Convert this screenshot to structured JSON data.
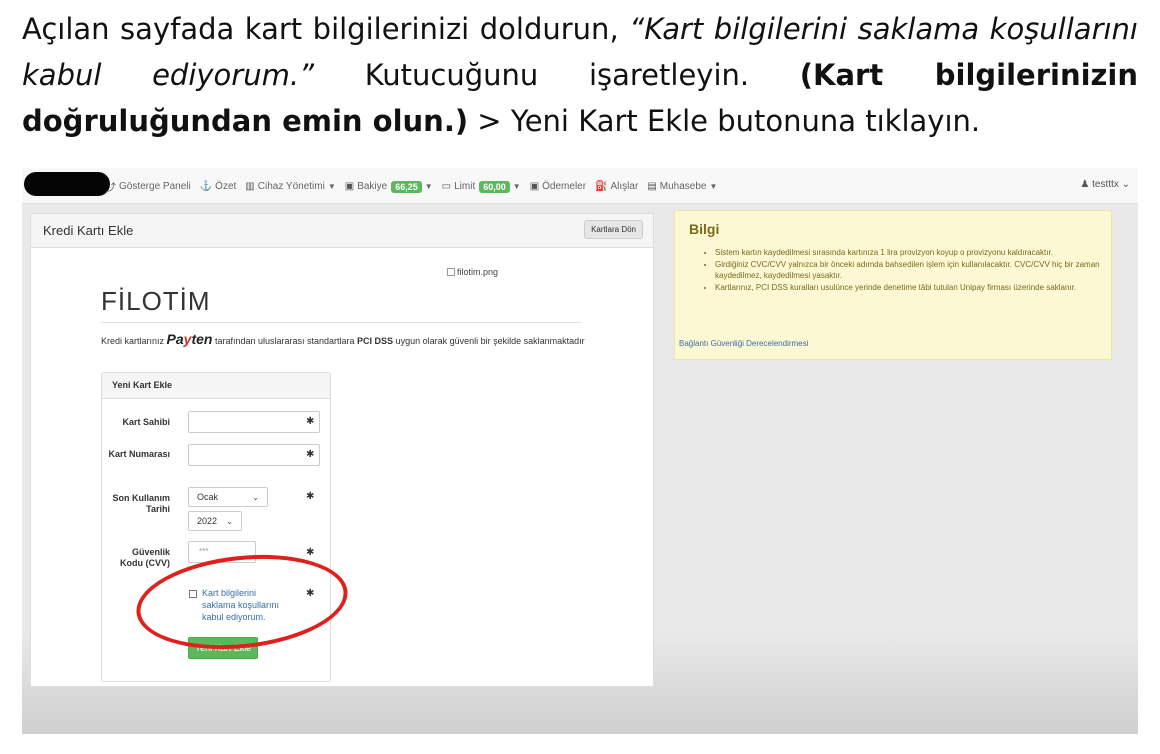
{
  "instruction": {
    "part1": "Açılan sayfada kart bilgilerinizi doldurun, ",
    "italic": "“Kart bilgilerini saklama koşullarını kabul ediyorum.”",
    "part2": " Kutucuğunu işaretleyin. ",
    "bold": "(Kart bilgilerinizin doğruluğundan emin olun.)",
    "part3": " > Yeni Kart Ekle butonuna tıklayın."
  },
  "nav": {
    "items": [
      {
        "icon": "chart-icon",
        "glyph": "⤴",
        "label": "Gösterge Paneli"
      },
      {
        "icon": "summary-icon",
        "glyph": "⚓",
        "label": "Özet"
      },
      {
        "icon": "device-icon",
        "glyph": "▥",
        "label": "Cihaz Yönetimi",
        "caret": true
      },
      {
        "icon": "balance-icon",
        "glyph": "▣",
        "label": "Bakiye",
        "badge": "66,25",
        "caret": true
      },
      {
        "icon": "limit-icon",
        "glyph": "▭",
        "label": "Limit",
        "badge": "60,00",
        "caret": true
      },
      {
        "icon": "payment-icon",
        "glyph": "▣",
        "label": "Ödemeler"
      },
      {
        "icon": "fuel-icon",
        "glyph": "⛽",
        "label": "Alışlar"
      },
      {
        "icon": "book-icon",
        "glyph": "▤",
        "label": "Muhasebe",
        "caret": true
      }
    ],
    "user": "testttx"
  },
  "panel": {
    "title": "Kredi Kartı Ekle",
    "back_button": "Kartlara Dön",
    "brand": "FİLOTİM",
    "logo_alt": "filotim.png",
    "pci_text_1": "Kredi kartlarınız ",
    "payten_pay": "Pa",
    "payten_y": "y",
    "payten_ten": "ten",
    "pci_text_2": " tarafından uluslararası standartlara ",
    "pci_bold": "PCI DSS",
    "pci_text_3": " uygun olarak güvenli bir şekilde saklanmaktadır"
  },
  "form": {
    "title": "Yeni Kart Ekle",
    "card_holder_label": "Kart Sahibi",
    "card_number_label": "Kart Numarası",
    "expiry_label": "Son Kullanım Tarihi",
    "expiry_month": "Ocak",
    "expiry_year": "2022",
    "cvv_label": "Güvenlik Kodu (CVV)",
    "cvv_placeholder": "***",
    "required_mark": "✱",
    "terms_label": "Kart bilgilerini saklama koşullarını kabul ediyorum.",
    "submit_button": "Yeni Kart Ekle"
  },
  "info": {
    "title": "Bilgi",
    "items": [
      "Sistem kartın kaydedilmesi sırasında kartınıza 1 lira provizyon koyup o provizyonu kaldıracaktır.",
      "Girdiğiniz CVC/CVV yalnızca bir önceki adımda bahsedilen işlem için kullanılacaktır. CVC/CVV hiç bir zaman kaydedilmez, kaydedilmesi yasaktır.",
      "Kartlarınız, PCI DSS kuralları usulünce yerinde denetime tâbi tutulan Unipay firması üzerinde saklanır."
    ],
    "link": "Bağlantı Güvenliği Derecelendirmesi"
  },
  "colors": {
    "success": "#5cb85c",
    "annotation_red": "#e0201c",
    "info_bg": "#fcf8d4"
  }
}
